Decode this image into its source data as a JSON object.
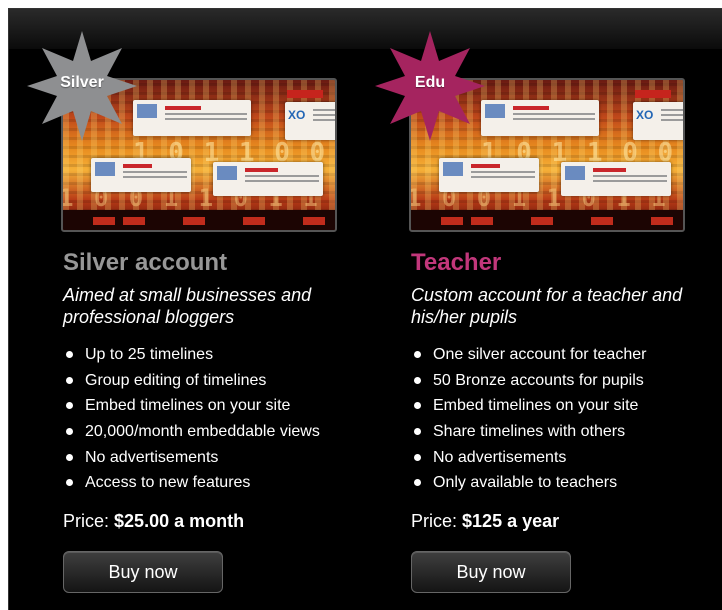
{
  "plans": [
    {
      "badge": "Silver",
      "badge_color": "#8e8f91",
      "title": "Silver account",
      "title_color": "#979797",
      "subtitle": "Aimed at small businesses and professional bloggers",
      "features": [
        "Up to 25 timelines",
        "Group editing of timelines",
        "Embed timelines on your site",
        "20,000/month embeddable views",
        "No advertisements",
        "Access to new features"
      ],
      "price_label": "Price:",
      "price_value": "$25.00 a month",
      "button": "Buy now"
    },
    {
      "badge": "Edu",
      "badge_color": "#a5245f",
      "title": "Teacher",
      "title_color": "#c2377b",
      "subtitle": "Custom account for a teacher and his/her pupils",
      "features": [
        "One silver account for teacher",
        "50 Bronze accounts for pupils",
        "Embed timelines on your site",
        "Share timelines with others",
        "No advertisements",
        "Only available to teachers"
      ],
      "price_label": "Price:",
      "price_value": "$125 a year",
      "button": "Buy now"
    }
  ],
  "thumbnail_icon": "timeline-screenshot-image",
  "background_color": "#000000"
}
